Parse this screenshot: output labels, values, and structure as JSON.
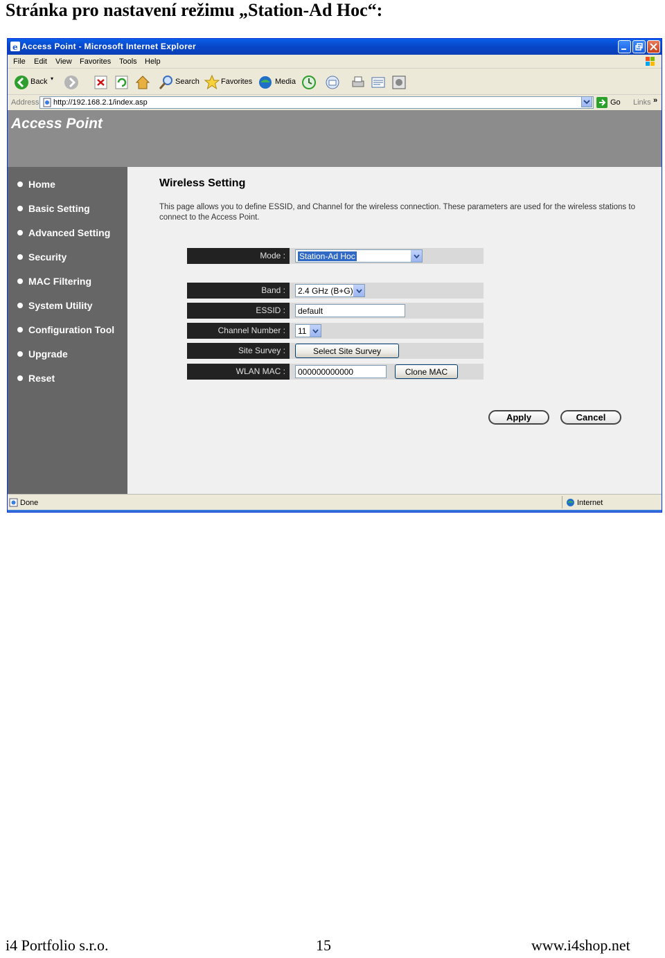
{
  "document": {
    "heading": "Stránka pro nastavení režimu „Station-Ad Hoc“:",
    "footer": {
      "company": "i4 Portfolio s.r.o.",
      "page_number": "15",
      "website": "www.i4shop.net"
    }
  },
  "browser": {
    "window_title": "Access Point - Microsoft Internet Explorer",
    "menu": [
      "File",
      "Edit",
      "View",
      "Favorites",
      "Tools",
      "Help"
    ],
    "toolbar": {
      "back": "Back",
      "search": "Search",
      "favorites": "Favorites",
      "media": "Media"
    },
    "address_label": "Address",
    "address_url": "http://192.168.2.1/index.asp",
    "go_label": "Go",
    "links_label": "Links",
    "links_chevron": "»",
    "status_text": "Done",
    "status_zone": "Internet"
  },
  "app": {
    "banner_title": "Access Point",
    "nav": [
      "Home",
      "Basic Setting",
      "Advanced Setting",
      "Security",
      "MAC Filtering",
      "System Utility",
      "Configuration Tool",
      "Upgrade",
      "Reset"
    ],
    "page_title": "Wireless Setting",
    "page_description": "This page allows you to define ESSID, and Channel for the wireless connection. These parameters are used for the wireless stations to connect to the Access Point.",
    "form": {
      "mode": {
        "label": "Mode :",
        "value": "Station-Ad Hoc"
      },
      "band": {
        "label": "Band :",
        "value": "2.4 GHz (B+G)"
      },
      "essid": {
        "label": "ESSID :",
        "value": "default"
      },
      "channel": {
        "label": "Channel Number :",
        "value": "11"
      },
      "site_survey": {
        "label": "Site Survey :",
        "button": "Select Site Survey"
      },
      "wlan_mac": {
        "label": "WLAN MAC :",
        "value": "000000000000",
        "button": "Clone MAC"
      }
    },
    "apply_label": "Apply",
    "cancel_label": "Cancel"
  }
}
